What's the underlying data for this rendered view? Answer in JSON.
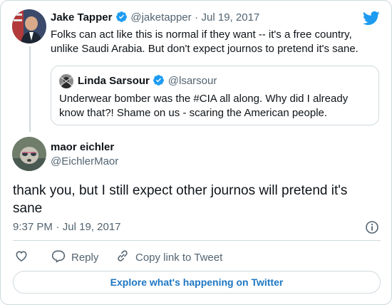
{
  "parent_tweet": {
    "author_name": "Jake Tapper",
    "author_handle": "@jaketapper",
    "separator": "·",
    "date": "Jul 19, 2017",
    "text_line1": "Folks can act like this is normal if they want -- it's a free country,",
    "text_line2": "unlike Saudi Arabia. But don't expect journos to pretend it's sane.",
    "verified_icon": "verified-badge-icon"
  },
  "quoted_tweet": {
    "author_name": "Linda Sarsour",
    "author_handle": "@lsarsour",
    "text_line1": "Underwear bomber was the #CIA all  along. Why did I already",
    "text_line2": "know that?! Shame on us - scaring the American people.",
    "verified_icon": "verified-badge-icon"
  },
  "main_tweet": {
    "author_name": "maor eichler",
    "author_handle": "@EichlerMaor",
    "text_line1": "thank you, but I still expect other journos will pretend it's",
    "text_line2": "sane",
    "time": "9:37 PM",
    "separator": "·",
    "date": "Jul 19, 2017"
  },
  "actions": {
    "like_icon": "heart-icon",
    "reply_icon": "reply-bubble-icon",
    "reply_label": "Reply",
    "copy_icon": "link-icon",
    "copy_label": "Copy link to Tweet",
    "info_icon": "info-icon"
  },
  "explore_label": "Explore what's happening on Twitter",
  "colors": {
    "twitter_blue": "#1d9bf0",
    "link_blue": "#1d77c2",
    "muted_gray": "#536471",
    "border_gray": "#cfd9de"
  }
}
